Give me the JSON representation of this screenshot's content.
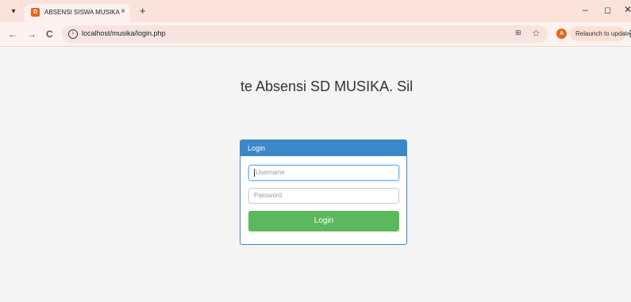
{
  "browser": {
    "tab_title": "ABSENSI SISWA MUSIKA",
    "favicon_text": "D",
    "tab_close": "×",
    "new_tab": "+",
    "url": "localhost/musika/login.php",
    "avatar_letter": "A",
    "relaunch_label": "Relaunch to update",
    "icons": {
      "menu": "▾",
      "back": "←",
      "forward": "→",
      "reload": "C",
      "info": "i",
      "translate": "⊞",
      "star": "☆",
      "kebab": "⋮",
      "minimize": "–",
      "restore": "◻",
      "close": "✕"
    },
    "colors": {
      "accent": "#e8641c",
      "tabbar": "#fbe3dc"
    }
  },
  "page": {
    "marquee_text": "te Absensi SD MUSIKA. Sil",
    "login_panel": {
      "heading": "Login",
      "username_placeholder": "Username",
      "password_placeholder": "Password",
      "submit_label": "Login"
    },
    "colors": {
      "panel_heading": "#3b88c8",
      "button": "#5cb85c"
    }
  }
}
